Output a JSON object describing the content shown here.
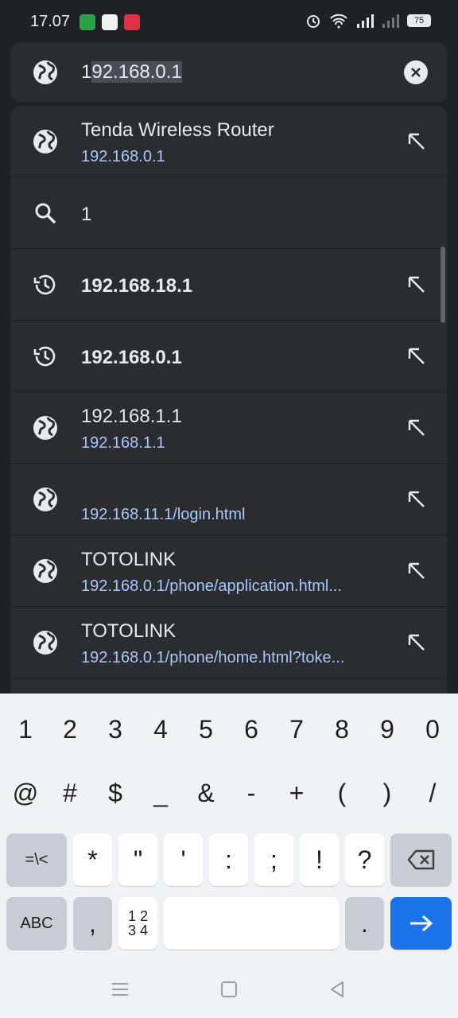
{
  "status_bar": {
    "time": "17.07",
    "battery": "75"
  },
  "omnibox": {
    "typed": "1",
    "selected_completion": "92.168.0.1"
  },
  "suggestions": [
    {
      "type": "site",
      "title": "Tenda Wireless Router",
      "url": "192.168.0.1",
      "bold": false
    },
    {
      "type": "search",
      "title": "1",
      "url": "",
      "bold": false
    },
    {
      "type": "history",
      "title": "192.168.18.1",
      "url": "",
      "bold": true
    },
    {
      "type": "history",
      "title": "192.168.0.1",
      "url": "",
      "bold": true
    },
    {
      "type": "site",
      "title": "192.168.1.1",
      "url": "192.168.1.1",
      "bold": false
    },
    {
      "type": "site",
      "title": "",
      "url": "192.168.11.1/login.html",
      "bold": false
    },
    {
      "type": "site",
      "title": "TOTOLINK",
      "url": "192.168.0.1/phone/application.html...",
      "bold": false
    },
    {
      "type": "site",
      "title": "TOTOLINK",
      "url": "192.168.0.1/phone/home.html?toke...",
      "bold": false
    }
  ],
  "keyboard": {
    "row1": [
      "1",
      "2",
      "3",
      "4",
      "5",
      "6",
      "7",
      "8",
      "9",
      "0"
    ],
    "row2": [
      "@",
      "#",
      "$",
      "_",
      "&",
      "-",
      "+",
      "(",
      ")",
      "/"
    ],
    "row3": [
      "=\\<",
      "*",
      "\"",
      "'",
      ":",
      ";",
      "!",
      "?"
    ],
    "abc_label": "ABC",
    "comma": ",",
    "numpad_label": "1 2\n3 4",
    "period": "."
  },
  "colors": {
    "accent": "#1a73e8",
    "url": "#a8c7fa",
    "surface": "#2b2c2f",
    "background": "#202124"
  }
}
